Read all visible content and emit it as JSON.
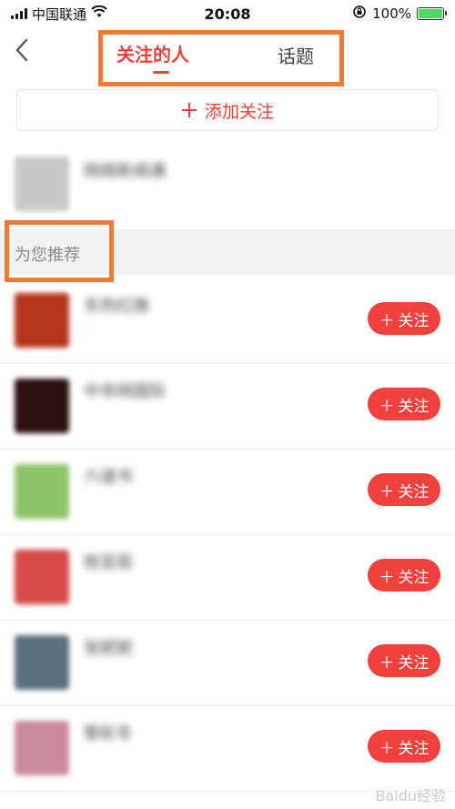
{
  "status_bar": {
    "carrier": "中国联通",
    "time": "20:08",
    "battery": "100%",
    "battery_level": 1.0
  },
  "nav": {
    "back_icon": "chevron-left-icon",
    "tabs": [
      {
        "label": "关注的人",
        "active": true
      },
      {
        "label": "话题",
        "active": false
      }
    ]
  },
  "add_follow": {
    "label": "添加关注",
    "icon": "plus-icon"
  },
  "followed": [
    {
      "name": "网络新闻通"
    }
  ],
  "section": {
    "title": "为您推荐"
  },
  "recommendations": [
    {
      "name": "东热红旗",
      "button": "关注",
      "avatar_color": "#b5341e"
    },
    {
      "name": "中非网国际",
      "button": "关注",
      "avatar_color": "#2a1010"
    },
    {
      "name": "六道书",
      "button": "关注",
      "avatar_color": "#8fc46a"
    },
    {
      "name": "枝芸茹",
      "button": "关注",
      "avatar_color": "#d64a4a"
    },
    {
      "name": "张妮妮",
      "button": "关注",
      "avatar_color": "#5b6f7d"
    },
    {
      "name": "黎彩冬",
      "button": "关注",
      "avatar_color": "#c98a9c"
    }
  ],
  "watermark": "Baidu经验"
}
